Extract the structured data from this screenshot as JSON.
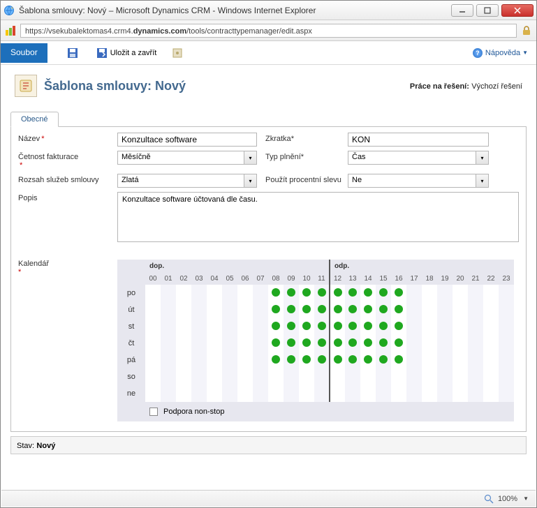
{
  "window": {
    "title": "Šablona smlouvy: Nový – Microsoft Dynamics CRM - Windows Internet Explorer",
    "url_pre": "https://vsekubalektomas4.crm4.",
    "url_bold": "dynamics.com",
    "url_post": "/tools/contracttypemanager/edit.aspx"
  },
  "ribbon": {
    "file": "Soubor",
    "save_close": "Uložit a zavřít",
    "help": "Nápověda"
  },
  "header": {
    "title": "Šablona smlouvy: Nový",
    "solution_label": "Práce na řešení:",
    "solution_value": "Výchozí řešení"
  },
  "tab": "Obecné",
  "form": {
    "name_label": "Název",
    "name_value": "Konzultace software",
    "abbr_label": "Zkratka",
    "abbr_value": "KON",
    "billing_label": "Četnost fakturace",
    "billing_value": "Měsíčně",
    "alloc_label": "Typ plnění",
    "alloc_value": "Čas",
    "service_label": "Rozsah služeb smlouvy",
    "service_value": "Zlatá",
    "discount_label": "Použít procentní slevu",
    "discount_value": "Ne",
    "desc_label": "Popis",
    "desc_value": "Konzultace software účtovaná dle času."
  },
  "calendar": {
    "label": "Kalendář",
    "am": "dop.",
    "pm": "odp.",
    "hours": [
      "00",
      "01",
      "02",
      "03",
      "04",
      "05",
      "06",
      "07",
      "08",
      "09",
      "10",
      "11",
      "12",
      "13",
      "14",
      "15",
      "16",
      "17",
      "18",
      "19",
      "20",
      "21",
      "22",
      "23"
    ],
    "days": [
      "po",
      "út",
      "st",
      "čt",
      "pá",
      "so",
      "ne"
    ],
    "hours_marked": [
      8,
      9,
      10,
      11,
      12,
      13,
      14,
      15,
      16
    ],
    "days_marked": [
      0,
      1,
      2,
      3,
      4
    ],
    "nonstop_label": "Podpora non-stop"
  },
  "status": {
    "label": "Stav:",
    "value": "Nový"
  },
  "footer": {
    "zoom": "100%"
  }
}
